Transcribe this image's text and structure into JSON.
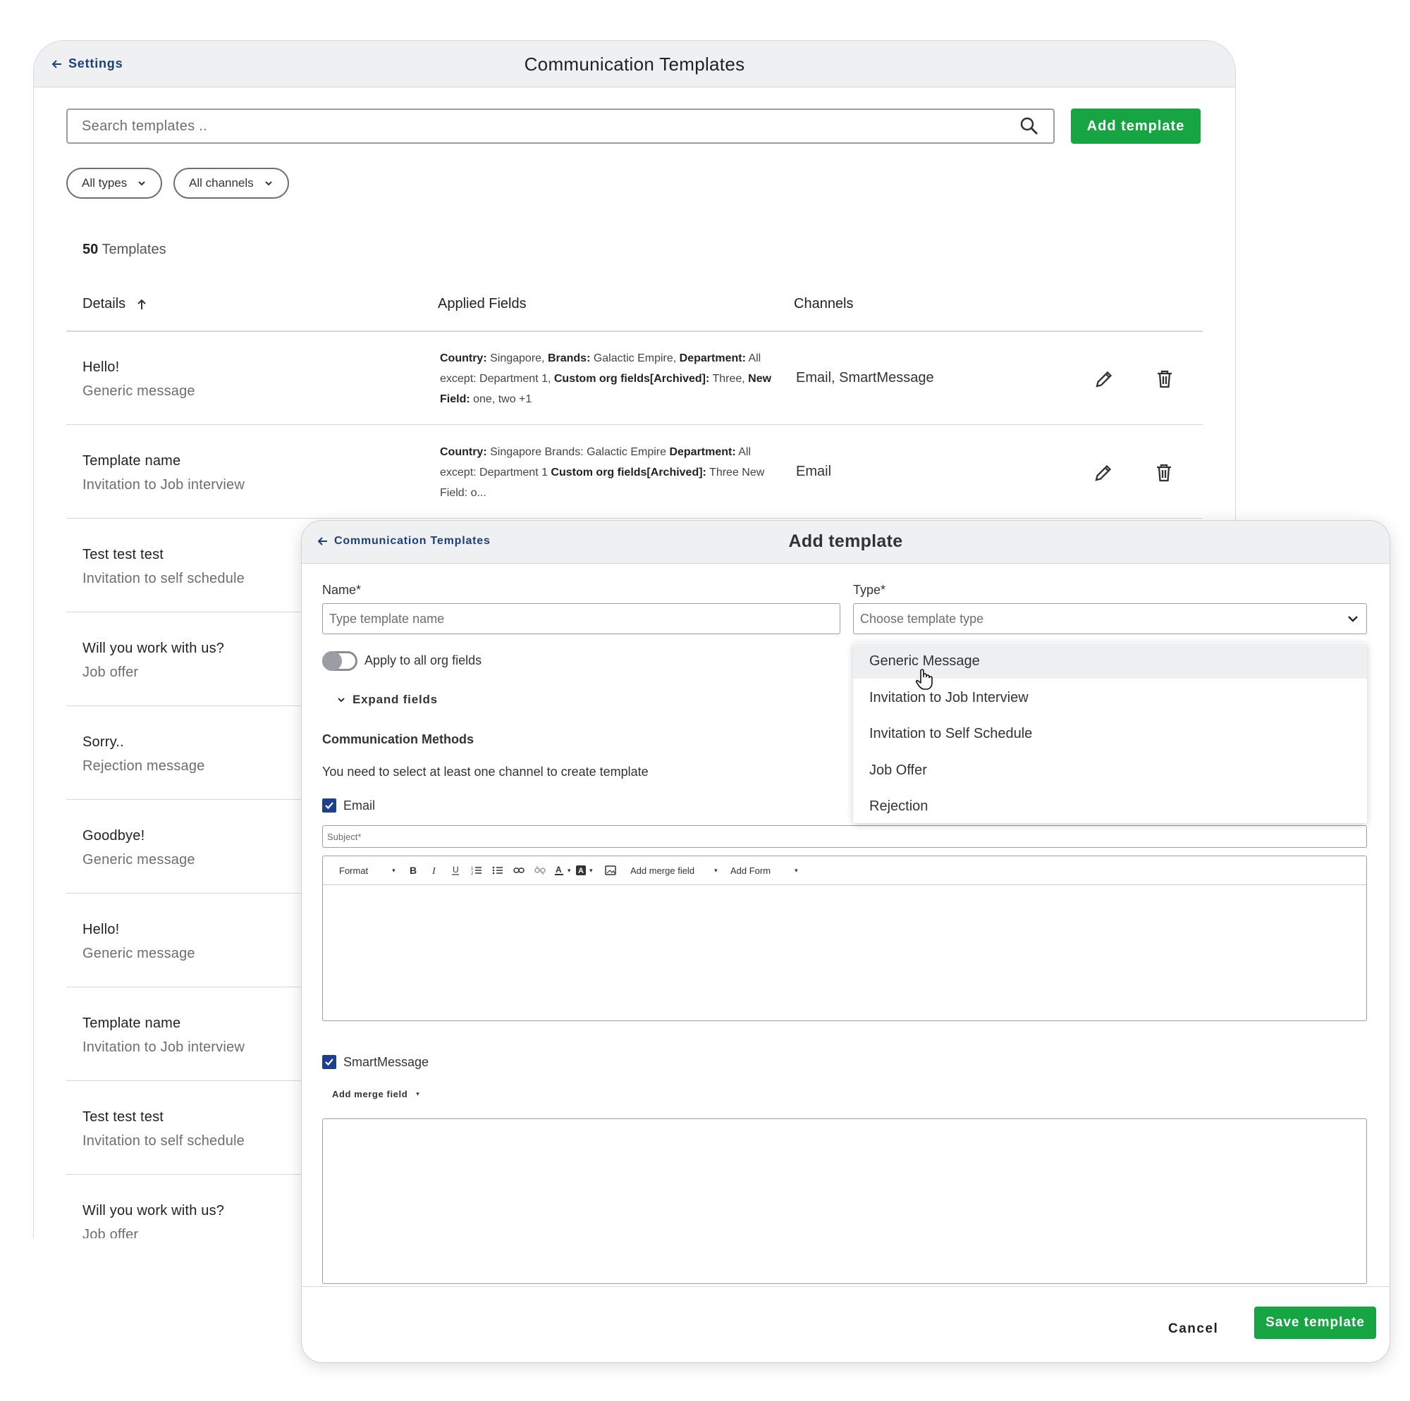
{
  "app": {
    "back_label": "Settings",
    "title": "Communication Templates",
    "search_placeholder": "Search templates ..",
    "add_button": "Add template",
    "filters": [
      "All types",
      "All channels"
    ],
    "count_number": "50",
    "count_label": "Templates",
    "columns": {
      "details": "Details",
      "applied_fields": "Applied Fields",
      "channels": "Channels"
    },
    "rows": [
      {
        "name": "Hello!",
        "type": "Generic message",
        "fields_html": "<b>Country:</b> Singapore, <b>Brands:</b> Galactic Empire, <b>Department:</b> All except: Department 1, <b>Custom org fields[Archived]:</b> Three, <b>New Field:</b> one, two +1",
        "channels": "Email, SmartMessage"
      },
      {
        "name": "Template name",
        "type": "Invitation to Job interview",
        "fields_html": "<b>Country:</b> Singapore Brands: Galactic Empire <b>Department:</b> All except: Department 1 <b>Custom org fields[Archived]:</b> Three New Field: o...",
        "channels": "Email"
      },
      {
        "name": "Test test test",
        "type": "Invitation to self schedule"
      },
      {
        "name": "Will you work with us?",
        "type": "Job offer"
      },
      {
        "name": "Sorry..",
        "type": "Rejection message"
      },
      {
        "name": "Goodbye!",
        "type": "Generic message"
      },
      {
        "name": "Hello!",
        "type": "Generic message"
      },
      {
        "name": "Template name",
        "type": "Invitation to Job interview"
      },
      {
        "name": "Test test test",
        "type": "Invitation to self schedule"
      },
      {
        "name": "Will you work with us?",
        "type": "Job offer"
      }
    ]
  },
  "modal": {
    "back_label": "Communication Templates",
    "title": "Add template",
    "name_label": "Name*",
    "name_placeholder": "Type template name",
    "type_label": "Type*",
    "type_placeholder": "Choose template type",
    "toggle_label": "Apply to all org fields",
    "expand_label": "Expand fields",
    "methods_title": "Communication Methods",
    "methods_hint": "You need to select at least one channel to create template",
    "email_label": "Email",
    "subject_placeholder": "Subject*",
    "toolbar": {
      "format": "Format",
      "merge": "Add merge field",
      "form": "Add Form"
    },
    "smart_label": "SmartMessage",
    "smart_merge": "Add merge field",
    "type_options": [
      "Generic Message",
      "Invitation to Job Interview",
      "Invitation to Self Schedule",
      "Job Offer",
      "Rejection"
    ],
    "highlighted_option": "Generic Message",
    "cancel": "Cancel",
    "save": "Save template"
  },
  "colors": {
    "accent_green": "#16a542",
    "link_blue": "#1d3f7a",
    "checkbox_blue": "#1d3f91"
  }
}
